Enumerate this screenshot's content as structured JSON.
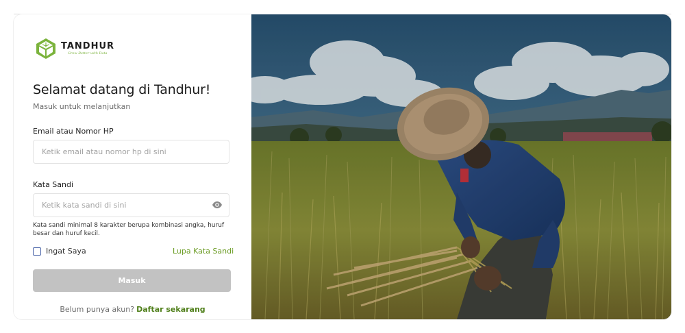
{
  "brand": {
    "name": "TANDHUR",
    "tagline": "Grow Better with Data"
  },
  "login": {
    "title": "Selamat datang di Tandhur!",
    "subtitle": "Masuk untuk melanjutkan",
    "email_label": "Email atau Nomor HP",
    "email_placeholder": "Ketik email atau nomor hp di sini",
    "password_label": "Kata Sandi",
    "password_placeholder": "Ketik kata sandi di sini",
    "password_hint": "Kata sandi minimal 8 karakter berupa kombinasi angka, huruf besar dan huruf kecil.",
    "remember_label": "Ingat Saya",
    "remember_checked": false,
    "forgot_label": "Lupa Kata Sandi",
    "submit_label": "Masuk",
    "register_prompt": "Belum punya akun?",
    "register_link": "Daftar sekarang"
  },
  "icons": [
    "tandhur-logo-icon",
    "eye-icon"
  ],
  "colors": {
    "brand_green": "#7bb33c",
    "link_green": "#6a9b22",
    "button_disabled": "#c2c2c2"
  }
}
